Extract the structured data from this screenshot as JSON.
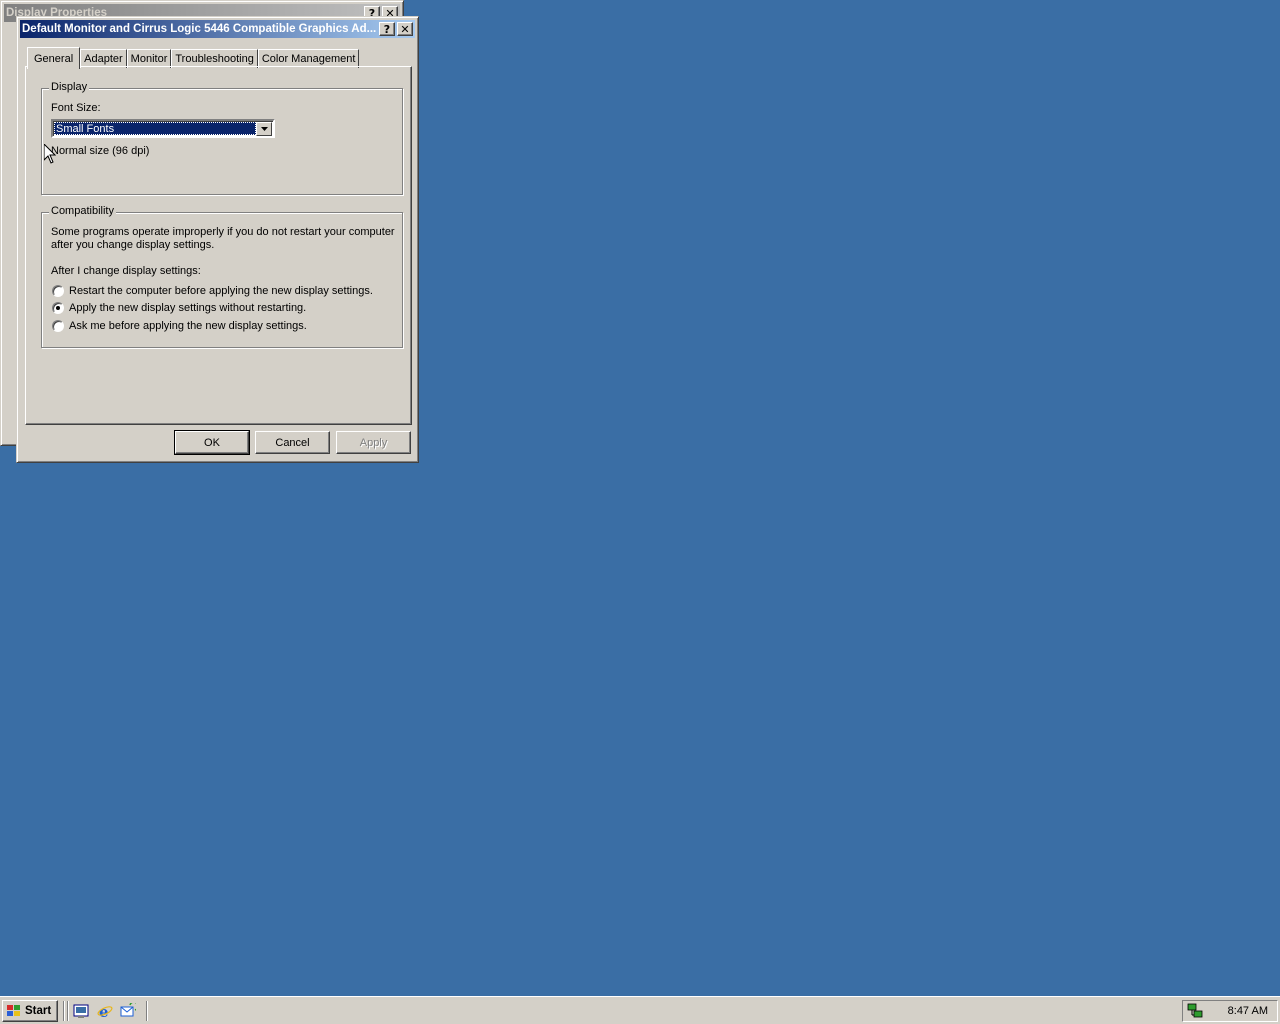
{
  "desktop": {
    "background": "#3a6ea5"
  },
  "back_window": {
    "title": "Display Properties",
    "help_btn": "?",
    "close_btn": "✕"
  },
  "dialog": {
    "title": "Default Monitor and Cirrus Logic 5446 Compatible Graphics Ad...",
    "help_btn": "?",
    "close_btn": "✕",
    "tabs": [
      {
        "label": "General",
        "selected": true
      },
      {
        "label": "Adapter"
      },
      {
        "label": "Monitor"
      },
      {
        "label": "Troubleshooting"
      },
      {
        "label": "Color Management"
      }
    ],
    "display_group": {
      "legend": "Display",
      "font_size_label": "Font Size:",
      "font_size_value": "Small Fonts",
      "font_size_desc": "Normal size (96 dpi)"
    },
    "compat_group": {
      "legend": "Compatibility",
      "note_line1": "Some programs operate improperly if you do not restart your computer",
      "note_line2": "after you change display settings.",
      "after_label": "After I change display settings:",
      "options": [
        {
          "label": "Restart the computer before applying the new display settings.",
          "checked": false
        },
        {
          "label": "Apply the new display settings without restarting.",
          "checked": true
        },
        {
          "label": "Ask me before applying the new display settings.",
          "checked": false
        }
      ]
    },
    "buttons": {
      "ok": "OK",
      "cancel": "Cancel",
      "apply": "Apply"
    }
  },
  "taskbar": {
    "start_label": "Start",
    "quicklaunch": [
      "show-desktop-icon",
      "internet-explorer-icon",
      "outlook-express-icon"
    ],
    "clock": "8:47 AM"
  }
}
